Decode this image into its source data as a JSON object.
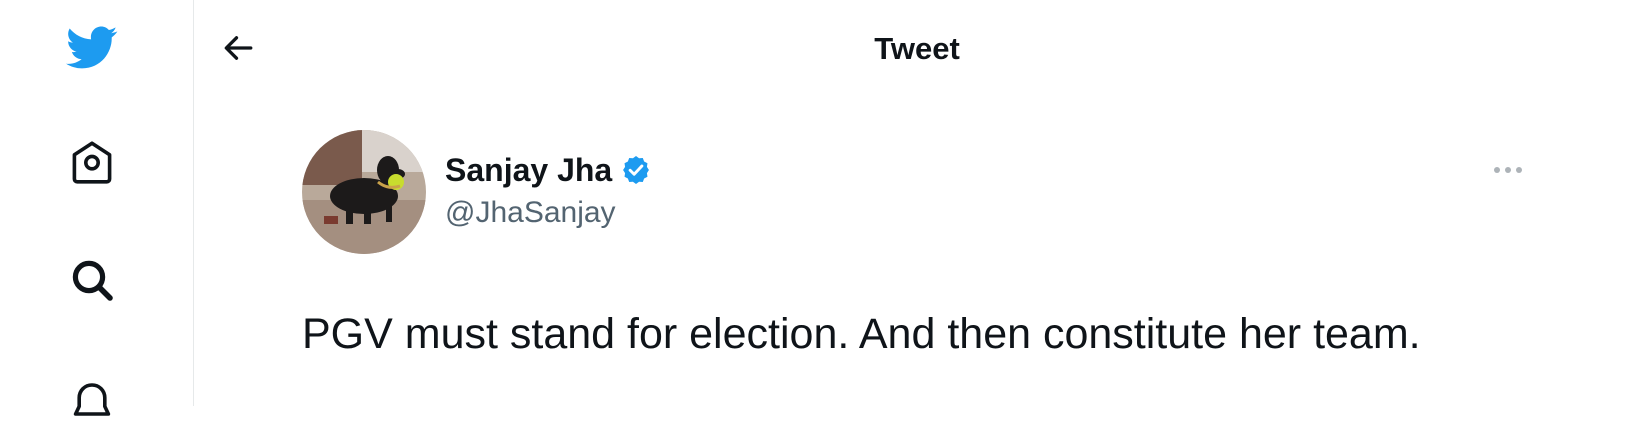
{
  "colors": {
    "brand": "#1d9bf0",
    "text_primary": "#0f1419",
    "text_secondary": "#536471",
    "border": "#e6e9ea"
  },
  "sidebar": {
    "items": [
      {
        "icon": "twitter-logo-icon"
      },
      {
        "icon": "home-icon"
      },
      {
        "icon": "search-icon"
      },
      {
        "icon": "notifications-icon"
      }
    ]
  },
  "header": {
    "title": "Tweet",
    "back_icon": "arrow-left-icon"
  },
  "tweet": {
    "author": {
      "name": "Sanjay Jha",
      "handle": "@JhaSanjay",
      "verified": true
    },
    "more_icon": "more-horizontal-icon",
    "text": "PGV must stand for election. And then constitute her team."
  }
}
